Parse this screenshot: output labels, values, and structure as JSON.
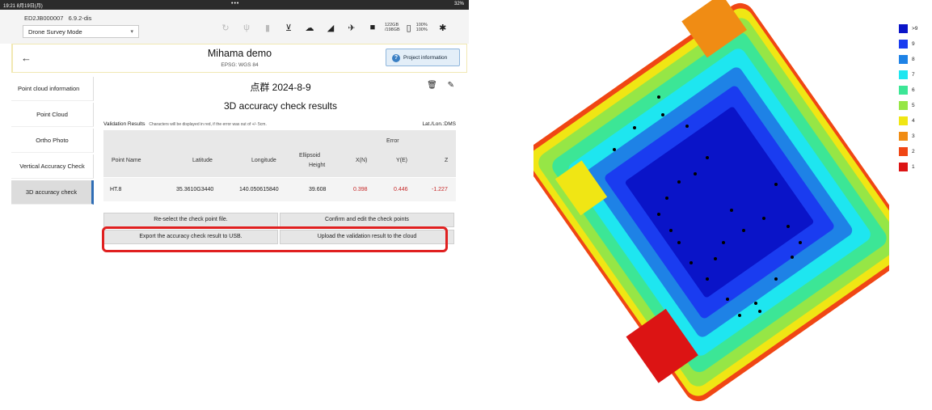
{
  "statusbar": {
    "time": "19:21  8月19日(月)",
    "dots": "•••",
    "battery": "32%"
  },
  "device": {
    "id": "ED2JB000007",
    "version": "6.9.2-dis"
  },
  "mode_select": {
    "value": "Drone Survey Mode"
  },
  "storage": {
    "used": "122GB",
    "total": "/198GB"
  },
  "battery_levels": {
    "a": "100%",
    "b": "100%"
  },
  "project": {
    "title": "Mihama demo",
    "crs": "EPSG: WGS 84",
    "info_button": "Project information"
  },
  "sidebar": {
    "items": [
      {
        "label": "Point cloud information"
      },
      {
        "label": "Point Cloud"
      },
      {
        "label": "Ortho Photo"
      },
      {
        "label": "Vertical Accuracy Check"
      },
      {
        "label": "3D accuracy check"
      }
    ]
  },
  "main": {
    "dataset": "点群 2024-8-9",
    "title": "3D accuracy check results",
    "validation_label": "Validation Results",
    "validation_note": "Characters will be displayed in red, if the error was out of +/- 5cm.",
    "coord_format": "Lat./Lon.:DMS"
  },
  "table": {
    "headers": {
      "point_name": "Point Name",
      "latitude": "Latitude",
      "longitude": "Longitude",
      "ellipsoid1": "Ellipsoid",
      "ellipsoid2": "Height",
      "error": "Error",
      "xn": "X(N)",
      "ye": "Y(E)",
      "z": "Z"
    },
    "rows": [
      {
        "name": "HT.8",
        "lat": "35.3610G3440",
        "lon": "140.050615840",
        "h": "39.608",
        "xn": "0.398",
        "ye": "0.446",
        "z": "-1.227"
      }
    ]
  },
  "buttons": {
    "reselect": "Re-select the check point file.",
    "confirm": "Confirm and edit the check points",
    "export": "Export the accuracy check result to USB.",
    "upload": "Upload the validation result to the cloud"
  },
  "legend": [
    {
      "label": ">9",
      "color": "#0a14c8"
    },
    {
      "label": "9",
      "color": "#1a3cf0"
    },
    {
      "label": "8",
      "color": "#1e82e6"
    },
    {
      "label": "7",
      "color": "#1ee6f0"
    },
    {
      "label": "6",
      "color": "#3ce696"
    },
    {
      "label": "5",
      "color": "#96e646"
    },
    {
      "label": "4",
      "color": "#f0e614"
    },
    {
      "label": "3",
      "color": "#f08c14"
    },
    {
      "label": "2",
      "color": "#f04614"
    },
    {
      "label": "1",
      "color": "#dc1414"
    }
  ]
}
